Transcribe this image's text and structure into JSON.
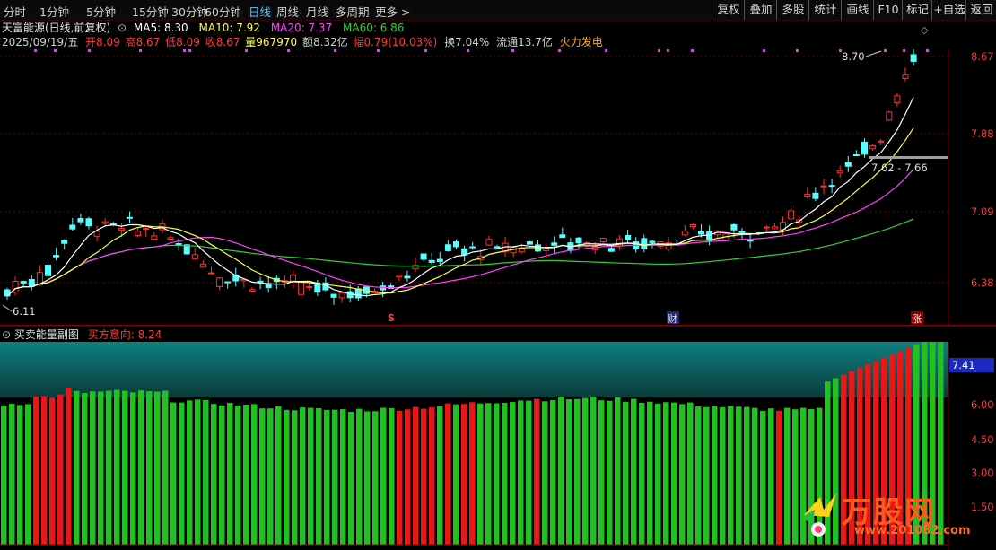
{
  "toolbar": {
    "periods": [
      "分时",
      "1分钟",
      "5分钟",
      "15分钟",
      "30分钟",
      "60分钟",
      "日线",
      "周线",
      "月线",
      "多周期",
      "更多"
    ],
    "active_period": "日线",
    "buttons": [
      "复权",
      "叠加",
      "多股",
      "统计",
      "画线",
      "F10",
      "标记",
      "+自选",
      "返回"
    ]
  },
  "stock": {
    "name": "天富能源(日线,前复权)",
    "ma5": "MA5: 8.30",
    "ma10": "MA10: 7.92",
    "ma20": "MA20: 7.37",
    "ma60": "MA60: 6.86",
    "date": "2025/09/19/五",
    "open": "开8.09",
    "high": "高8.67",
    "low": "低8.09",
    "close": "收8.67",
    "volume": "量967970",
    "amount": "额8.32亿",
    "change": "幅0.79(10.03%)",
    "turnover": "换7.04%",
    "float": "流通13.7亿",
    "concept": "火力发电"
  },
  "main_chart": {
    "price_axis": [
      "8.67",
      "7.88",
      "7.09",
      "6.38"
    ],
    "high_label": "8.70",
    "low_label": "6.11",
    "range_label": "7.62 - 7.66",
    "markers": [
      "S",
      "财",
      "涨"
    ]
  },
  "sub_chart": {
    "title": "买卖能量副图",
    "indicator": "买方意向: 8.24",
    "axis": [
      "6.00",
      "4.50",
      "3.00",
      "1.50"
    ],
    "current_value": "7.41"
  },
  "watermark": {
    "brand": "万股网",
    "url": "www.201082.com"
  },
  "colors": {
    "up": "#ff3030",
    "down": "#54ffff",
    "ma5": "#ffffff",
    "ma10": "#ffff40",
    "ma20": "#ff40ff",
    "ma60": "#30d030",
    "bar_green": "#22c022",
    "bar_red": "#e81818"
  }
}
